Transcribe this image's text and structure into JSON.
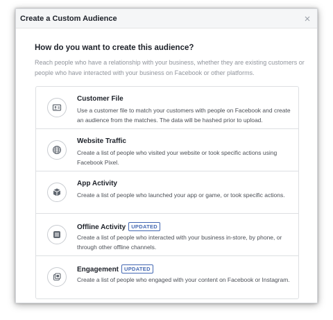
{
  "dialog": {
    "title": "Create a Custom Audience",
    "close_label": "×",
    "question": "How do you want to create this audience?",
    "intro": "Reach people who have a relationship with your business, whether they are existing customers or people who have interacted with your business on Facebook or other platforms."
  },
  "options": [
    {
      "title": "Customer File",
      "badge": "",
      "description": "Use a customer file to match your customers with people on Facebook and create an audience from the matches. The data will be hashed prior to upload.",
      "icon": "customer-file-icon"
    },
    {
      "title": "Website Traffic",
      "badge": "",
      "description": "Create a list of people who visited your website or took specific actions using Facebook Pixel.",
      "icon": "globe-icon"
    },
    {
      "title": "App Activity",
      "badge": "",
      "description": "Create a list of people who launched your app or game, or took specific actions.",
      "icon": "cube-icon"
    },
    {
      "title": "Offline Activity",
      "badge": "UPDATED",
      "description": "Create a list of people who interacted with your business in-store, by phone, or through other offline channels.",
      "icon": "store-icon"
    },
    {
      "title": "Engagement",
      "badge": "UPDATED",
      "description": "Create a list of people who engaged with your content on Facebook or Instagram.",
      "icon": "engagement-icon"
    }
  ],
  "colors": {
    "accent": "#4267b2",
    "header_bg": "#f5f6f7",
    "text": "#1d2129",
    "muted": "#90949c"
  }
}
